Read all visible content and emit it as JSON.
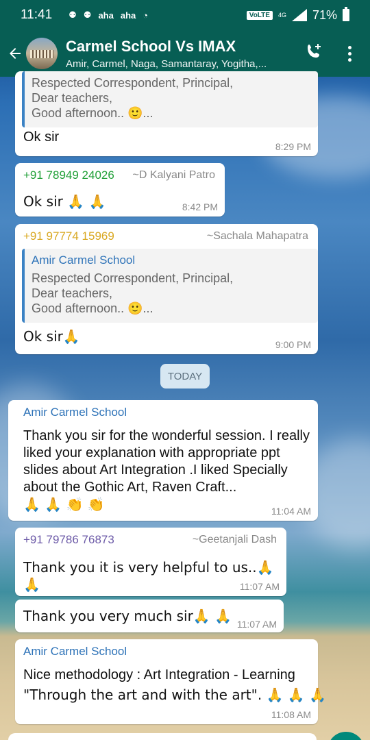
{
  "status": {
    "time": "11:41",
    "carrier_tags": [
      "aha",
      "aha"
    ],
    "volte": "VoLTE",
    "network": "4G",
    "battery": "71%"
  },
  "header": {
    "title": "Carmel School Vs IMAX",
    "members": "Amir, Carmel, Naga, Samantaray, Yogitha,..."
  },
  "messages": [
    {
      "quote_lines": [
        "Respected Correspondent, Principal,",
        "Dear teachers,",
        "Good afternoon.. 🙂..."
      ],
      "text": "Ok sir",
      "time": "8:29 PM"
    },
    {
      "sender": "+91 78949 24026",
      "sender_alt": "~D Kalyani Patro",
      "sender_color": "#21a038",
      "text": "Ok sir 🙏 🙏",
      "time": "8:42 PM"
    },
    {
      "sender": "+91 97774 15969",
      "sender_alt": "~Sachala Mahapatra",
      "sender_color": "#d9a821",
      "quote_author": "Amir Carmel School",
      "quote_lines": [
        "Respected Correspondent, Principal,",
        "Dear teachers,",
        "Good afternoon.. 🙂..."
      ],
      "text": "Ok sir🙏",
      "time": "9:00 PM"
    },
    {
      "sender": "Amir Carmel School",
      "sender_color": "#2e73b8",
      "text": "Thank you sir for the wonderful session. I really liked your explanation with appropriate ppt slides about Art Integration .I liked Specially about the Gothic Art, Raven Craft...",
      "emoji_line": "🙏 🙏 👏 👏",
      "time": "11:04 AM"
    },
    {
      "sender": "+91 79786 76873",
      "sender_alt": "~Geetanjali Dash",
      "sender_color": "#6d5ba8",
      "text": "Thank you it is very  helpful to us..🙏 🙏",
      "time": "11:07 AM"
    },
    {
      "text": "Thank you very much sir🙏 🙏",
      "time": "11:07 AM"
    },
    {
      "sender": "Amir Carmel School",
      "sender_color": "#2e73b8",
      "text_line1": "Nice methodology : Art Integration - Learning",
      "text_line2": "\"Through the art and with the art\". 🙏 🙏 🙏",
      "time": "11:08 AM"
    }
  ],
  "date_divider": "TODAY"
}
